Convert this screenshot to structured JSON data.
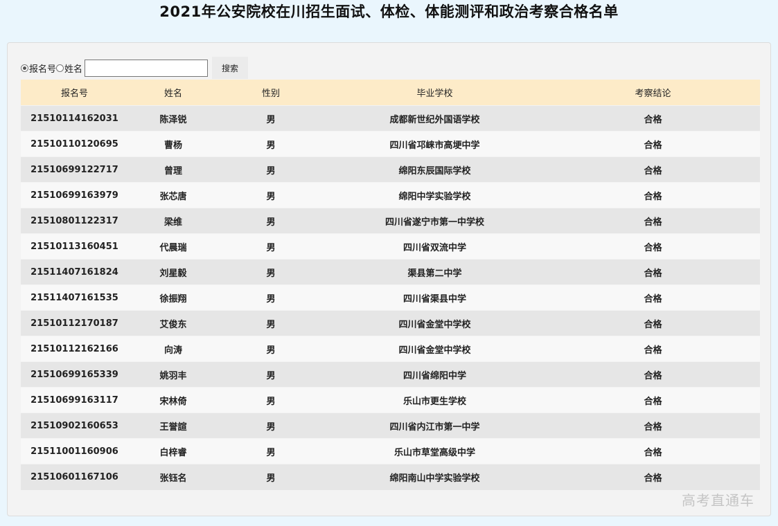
{
  "page": {
    "title": "2021年公安院校在川招生面试、体检、体能测评和政治考察合格名单"
  },
  "search": {
    "radio_id_label": "报名号",
    "radio_name_label": "姓名",
    "input_value": "",
    "button_label": "搜索"
  },
  "table": {
    "headers": {
      "id": "报名号",
      "name": "姓名",
      "gender": "性别",
      "school": "毕业学校",
      "result": "考察结论"
    },
    "rows": [
      {
        "id": "21510114162031",
        "name": "陈泽锐",
        "gender": "男",
        "school": "成都新世纪外国语学校",
        "result": "合格"
      },
      {
        "id": "21510110120695",
        "name": "曹杨",
        "gender": "男",
        "school": "四川省邛崃市高埂中学",
        "result": "合格"
      },
      {
        "id": "21510699122717",
        "name": "曾理",
        "gender": "男",
        "school": "绵阳东辰国际学校",
        "result": "合格"
      },
      {
        "id": "21510699163979",
        "name": "张芯唐",
        "gender": "男",
        "school": "绵阳中学实验学校",
        "result": "合格"
      },
      {
        "id": "21510801122317",
        "name": "梁维",
        "gender": "男",
        "school": "四川省遂宁市第一中学校",
        "result": "合格"
      },
      {
        "id": "21510113160451",
        "name": "代晨瑞",
        "gender": "男",
        "school": "四川省双流中学",
        "result": "合格"
      },
      {
        "id": "21511407161824",
        "name": "刘星毅",
        "gender": "男",
        "school": "渠县第二中学",
        "result": "合格"
      },
      {
        "id": "21511407161535",
        "name": "徐振翔",
        "gender": "男",
        "school": "四川省渠县中学",
        "result": "合格"
      },
      {
        "id": "21510112170187",
        "name": "艾俊东",
        "gender": "男",
        "school": "四川省金堂中学校",
        "result": "合格"
      },
      {
        "id": "21510112162166",
        "name": "向涛",
        "gender": "男",
        "school": "四川省金堂中学校",
        "result": "合格"
      },
      {
        "id": "21510699165339",
        "name": "姚羽丰",
        "gender": "男",
        "school": "四川省绵阳中学",
        "result": "合格"
      },
      {
        "id": "21510699163117",
        "name": "宋林倚",
        "gender": "男",
        "school": "乐山市更生学校",
        "result": "合格"
      },
      {
        "id": "21510902160653",
        "name": "王誉諠",
        "gender": "男",
        "school": "四川省内江市第一中学",
        "result": "合格"
      },
      {
        "id": "21511001160906",
        "name": "白梓睿",
        "gender": "男",
        "school": "乐山市草堂高级中学",
        "result": "合格"
      },
      {
        "id": "21510601167106",
        "name": "张钰名",
        "gender": "男",
        "school": "绵阳南山中学实验学校",
        "result": "合格"
      }
    ]
  },
  "watermark": {
    "text": "高考直通车"
  }
}
